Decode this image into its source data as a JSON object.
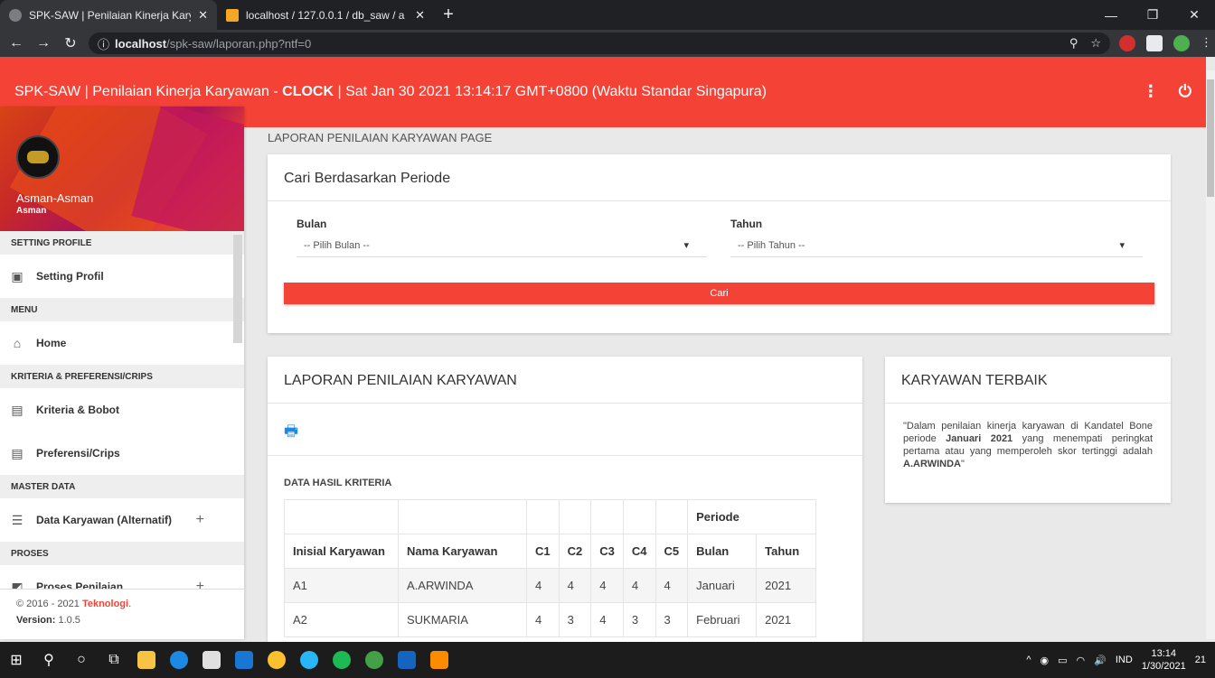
{
  "browser": {
    "tabs": [
      {
        "title": "SPK-SAW | Penilaian Kinerja Kary",
        "active": true
      },
      {
        "title": "localhost / 127.0.0.1 / db_saw / a",
        "active": false
      }
    ],
    "url_host": "localhost",
    "url_path": "/spk-saw/laporan.php?ntf=0"
  },
  "header": {
    "app_title": "SPK-SAW | Penilaian Kinerja Karyawan",
    "separator": " - ",
    "clock_label": "CLOCK",
    "clock_value": " | Sat Jan 30 2021 13:14:17 GMT+0800 (Waktu Standar Singapura)"
  },
  "sidebar": {
    "user_name": "Asman-Asman",
    "user_role": "Asman",
    "sections": {
      "setting": "SETTING PROFILE",
      "menu": "MENU",
      "kriteria": "KRITERIA & PREFERENSI/CRIPS",
      "master": "MASTER DATA",
      "proses": "PROSES"
    },
    "items": {
      "setting_profil": "Setting Profil",
      "home": "Home",
      "kriteria_bobot": "Kriteria & Bobot",
      "preferensi": "Preferensi/Crips",
      "data_karyawan": "Data Karyawan (Alternatif)",
      "proses_penilaian": "Proses Penilaian"
    },
    "footer_copy": "© 2016 - 2021 ",
    "footer_brand": "Teknologi",
    "footer_dot": ".",
    "version_label": "Version:",
    "version_value": " 1.0.5"
  },
  "main": {
    "page_title": "LAPORAN PENILAIAN KARYAWAN PAGE",
    "search": {
      "title": "Cari Berdasarkan Periode",
      "bulan_label": "Bulan",
      "bulan_placeholder": "-- Pilih Bulan --",
      "tahun_label": "Tahun",
      "tahun_placeholder": "-- Pilih Tahun --",
      "button": "Cari"
    },
    "report": {
      "title": "LAPORAN PENILAIAN KARYAWAN",
      "subtitle": "DATA HASIL KRITERIA",
      "headers": {
        "periode": "Periode",
        "inisial": "Inisial Karyawan",
        "nama": "Nama Karyawan",
        "c1": "C1",
        "c2": "C2",
        "c3": "C3",
        "c4": "C4",
        "c5": "C5",
        "bulan": "Bulan",
        "tahun": "Tahun"
      },
      "rows": [
        {
          "inisial": "A1",
          "nama": "A.ARWINDA",
          "c1": "4",
          "c2": "4",
          "c3": "4",
          "c4": "4",
          "c5": "4",
          "bulan": "Januari",
          "tahun": "2021"
        },
        {
          "inisial": "A2",
          "nama": "SUKMARIA",
          "c1": "4",
          "c2": "3",
          "c3": "4",
          "c4": "3",
          "c5": "3",
          "bulan": "Februari",
          "tahun": "2021"
        }
      ]
    },
    "best": {
      "title": "KARYAWAN TERBAIK",
      "q1": "\"Dalam penilaian kinerja karyawan di Kandatel Bone periode ",
      "period": "Januari 2021",
      "q2": " yang menempati peringkat pertama atau yang memperoleh skor tertinggi adalah ",
      "name": "A.ARWINDA",
      "q3": "\""
    }
  },
  "taskbar": {
    "lang": "IND",
    "time": "13:14",
    "date": "1/30/2021",
    "notif_count": "21"
  }
}
